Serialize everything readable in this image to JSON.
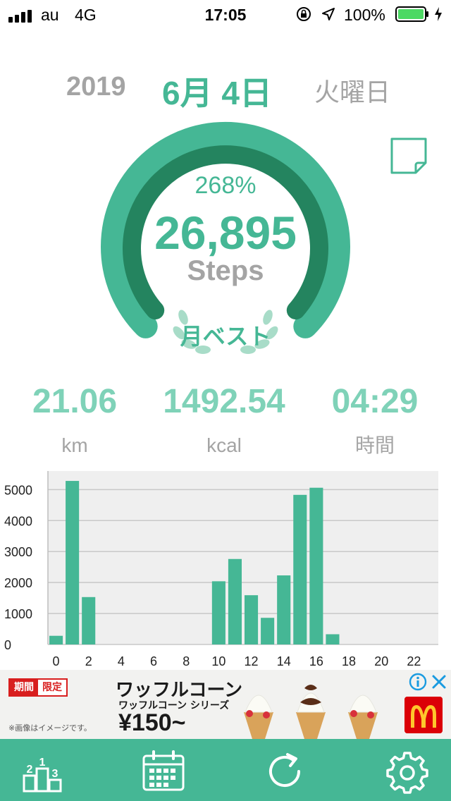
{
  "status_bar": {
    "carrier": "au",
    "network": "4G",
    "time": "17:05",
    "battery_percent": "100%",
    "icons": [
      "signal-bars-icon",
      "orientation-lock-icon",
      "location-arrow-icon",
      "battery-icon",
      "charging-bolt-icon"
    ]
  },
  "date": {
    "year": "2019",
    "month_day": "6月 4日",
    "weekday": "火曜日"
  },
  "memo_icon": "sticky-note-icon",
  "ring": {
    "percent": "268%",
    "steps": "26,895",
    "unit": "Steps",
    "best_label": "月ベスト",
    "progress_fraction": 1.0
  },
  "stats": [
    {
      "value": "21.06",
      "label": "km"
    },
    {
      "value": "1492.54",
      "label": "kcal"
    },
    {
      "value": "04:29",
      "label": "時間"
    }
  ],
  "chart_data": {
    "type": "bar",
    "x": [
      0,
      1,
      2,
      3,
      4,
      5,
      6,
      7,
      8,
      9,
      10,
      11,
      12,
      13,
      14,
      15,
      16,
      17,
      18,
      19,
      20,
      21,
      22,
      23
    ],
    "values": [
      280,
      5280,
      1530,
      0,
      0,
      0,
      0,
      0,
      0,
      0,
      2040,
      2760,
      1590,
      860,
      2230,
      4830,
      5060,
      330,
      0,
      0,
      0,
      0,
      0,
      0
    ],
    "x_ticks": [
      "0",
      "2",
      "4",
      "6",
      "8",
      "10",
      "12",
      "14",
      "16",
      "18",
      "20",
      "22"
    ],
    "y_ticks": [
      "0",
      "1000",
      "2000",
      "3000",
      "4000",
      "5000"
    ],
    "ylim": [
      0,
      5600
    ],
    "grid": true,
    "bar_color": "#45b795"
  },
  "ad": {
    "badge_left": "期間",
    "badge_right": "限定",
    "title": "ワッフルコーン",
    "subtitle": "ワッフルコーン シリーズ",
    "price": "¥150~",
    "note": "※画像はイメージです。",
    "icons": [
      "ad-info-icon",
      "ad-close-icon",
      "mcdonalds-logo"
    ]
  },
  "tab_bar": {
    "color": "#45b795",
    "tabs": [
      "ranking-podium-icon",
      "calendar-icon",
      "refresh-icon",
      "settings-gear-icon"
    ]
  },
  "colors": {
    "accent": "#45b795",
    "accent_dark": "#24845f",
    "light_accent": "#7fd2b8",
    "gray": "#a4a4a4"
  }
}
